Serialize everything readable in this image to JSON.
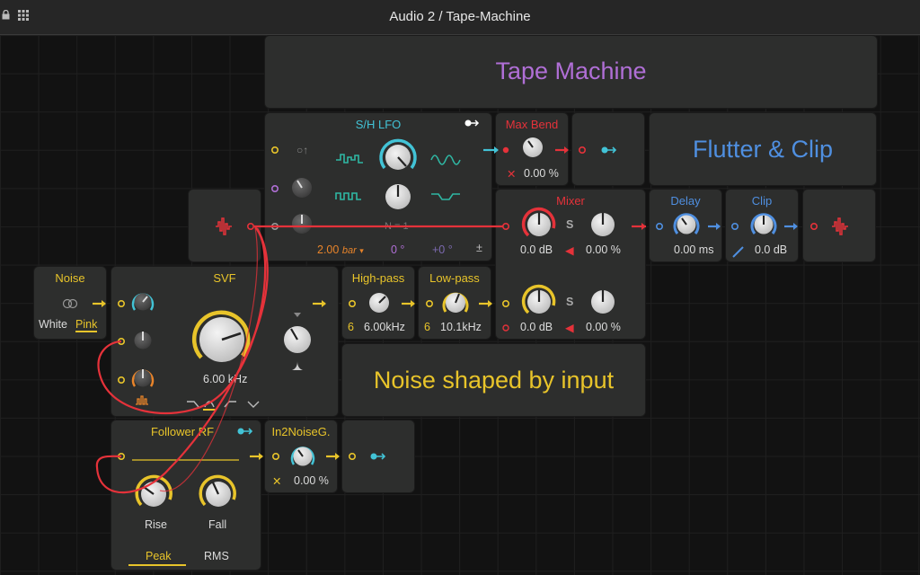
{
  "window": {
    "title": "Audio 2 / Tape-Machine",
    "lock_icon": "lock-icon",
    "grid_icon": "grid-icon"
  },
  "colors": {
    "yellow": "#e8c42a",
    "red": "#e5323a",
    "cyan": "#42c3d6",
    "purple": "#b06fd6",
    "blue": "#4f8fe0",
    "orange": "#e8842a",
    "teal": "#2fb7a3"
  },
  "notes": {
    "tape_machine": "Tape Machine",
    "flutter_clip": "Flutter & Clip",
    "noise_shaped": "Noise shaped by input"
  },
  "sh_lfo": {
    "title": "S/H LFO",
    "rate": "2.00",
    "rate_unit": "bar",
    "phase": "0 °",
    "offset": "+0 °",
    "n": "N = 1",
    "plusminus": "±"
  },
  "max_bend": {
    "title": "Max Bend",
    "value": "0.00 %"
  },
  "mixer": {
    "title": "Mixer",
    "gain1": "0.0 dB",
    "mix1": "0.00 %",
    "gain2": "0.0 dB",
    "mix2": "0.00 %",
    "s_label": "S"
  },
  "delay": {
    "title": "Delay",
    "value": "0.00 ms"
  },
  "clip": {
    "title": "Clip",
    "value": "0.0 dB"
  },
  "noise": {
    "title": "Noise",
    "opt_white": "White",
    "opt_pink": "Pink"
  },
  "svf": {
    "title": "SVF",
    "freq": "6.00 kHz"
  },
  "highpass": {
    "title": "High-pass",
    "order": "6",
    "value": "6.00kHz"
  },
  "lowpass": {
    "title": "Low-pass",
    "order": "6",
    "value": "10.1kHz"
  },
  "follower": {
    "title": "Follower RF",
    "rise": "Rise",
    "fall": "Fall",
    "mode_peak": "Peak",
    "mode_rms": "RMS"
  },
  "in2noise": {
    "title": "In2NoiseG.",
    "value": "0.00 %"
  }
}
